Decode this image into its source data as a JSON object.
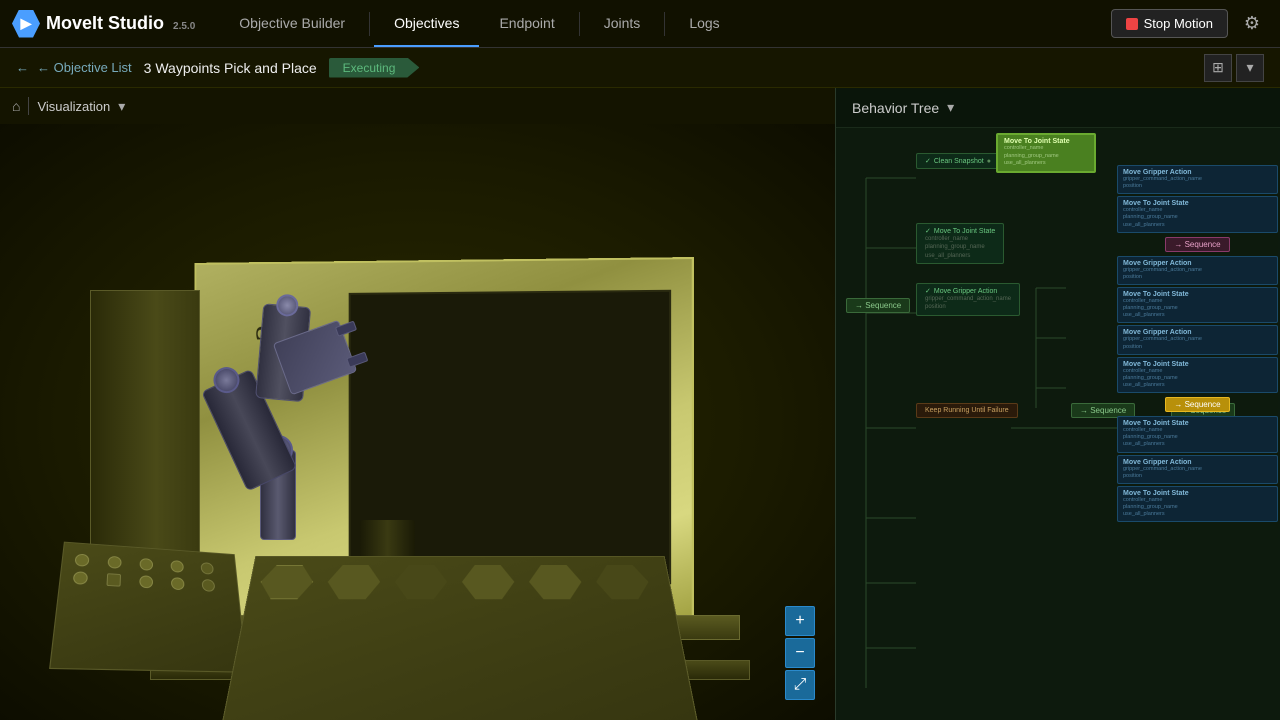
{
  "app": {
    "logo_text": "MoveIt Studio",
    "logo_version": "2.5.0",
    "logo_icon": "▶"
  },
  "nav": {
    "items": [
      {
        "id": "objective-builder",
        "label": "Objective Builder",
        "active": false
      },
      {
        "id": "objectives",
        "label": "Objectives",
        "active": true
      },
      {
        "id": "endpoint",
        "label": "Endpoint",
        "active": false
      },
      {
        "id": "joints",
        "label": "Joints",
        "active": false
      },
      {
        "id": "logs",
        "label": "Logs",
        "active": false
      }
    ],
    "stop_motion_label": "Stop Motion",
    "settings_icon": "⚙"
  },
  "breadcrumb": {
    "back_label": "← Objective List",
    "page_title": "3 Waypoints Pick and Place",
    "status": "Executing",
    "layout_icon": "⊞"
  },
  "viz_panel": {
    "home_icon": "⌂",
    "label": "Visualization",
    "dropdown_icon": "▾",
    "zoom_in": "+",
    "zoom_out": "−",
    "fit": "⤢"
  },
  "behavior_tree": {
    "title": "Behavior Tree",
    "dropdown_icon": "▾",
    "nodes": {
      "main_sequence": "Sequence",
      "clean_snapshot": "Clean Snapshot",
      "move_to_joint_state_1": "Move To Joint State",
      "move_gripper_1": "Move Gripper Action",
      "keep_running": "Keep Running Until Failure",
      "sequence_mid": "Sequence",
      "sequence_right": "Sequence",
      "sequence_pink": "Sequence",
      "move_to_joint_2": "Move To Joint State",
      "move_gripper_2": "Move Gripper Action",
      "move_to_joint_3": "Move To Joint State",
      "move_gripper_3": "Move Gripper Action",
      "move_to_joint_4": "Move To Joint State",
      "move_gripper_4": "Move Gripper Action",
      "move_to_joint_5": "Move To Joint State",
      "move_gripper_5": "Move Gripper Action",
      "move_to_joint_6": "Move To Joint State"
    },
    "node_details": {
      "controller_name": "controller_name",
      "planning_group_name": "planning_group_name",
      "use_all_planners": "use_all_planners",
      "gripper_command": "gripper_command_action_name",
      "position": "position"
    }
  }
}
